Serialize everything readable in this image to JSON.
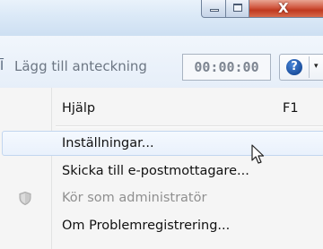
{
  "window": {
    "minimize_icon": "minimize-icon",
    "maximize_icon": "maximize-icon",
    "close_glyph": "X"
  },
  "toolbar": {
    "note_label": "Lägg till anteckning",
    "timer_value": "00:00:00",
    "help_glyph": "?",
    "help_arrow": "▾"
  },
  "menu": {
    "items": [
      {
        "label": "Hjälp",
        "shortcut": "F1",
        "enabled": true,
        "highlighted": false
      },
      {
        "label": "Inställningar...",
        "shortcut": "",
        "enabled": true,
        "highlighted": true
      },
      {
        "label": "Skicka till e-postmottagare...",
        "shortcut": "",
        "enabled": true,
        "highlighted": false
      },
      {
        "label": "Kör som administratör",
        "shortcut": "",
        "enabled": false,
        "highlighted": false
      },
      {
        "label": "Om Problemregistrering...",
        "shortcut": "",
        "enabled": true,
        "highlighted": false
      }
    ]
  },
  "colors": {
    "close_button": "#c0391f",
    "highlight_border": "#c2d6ef",
    "disabled_text": "#8f8f8f"
  }
}
